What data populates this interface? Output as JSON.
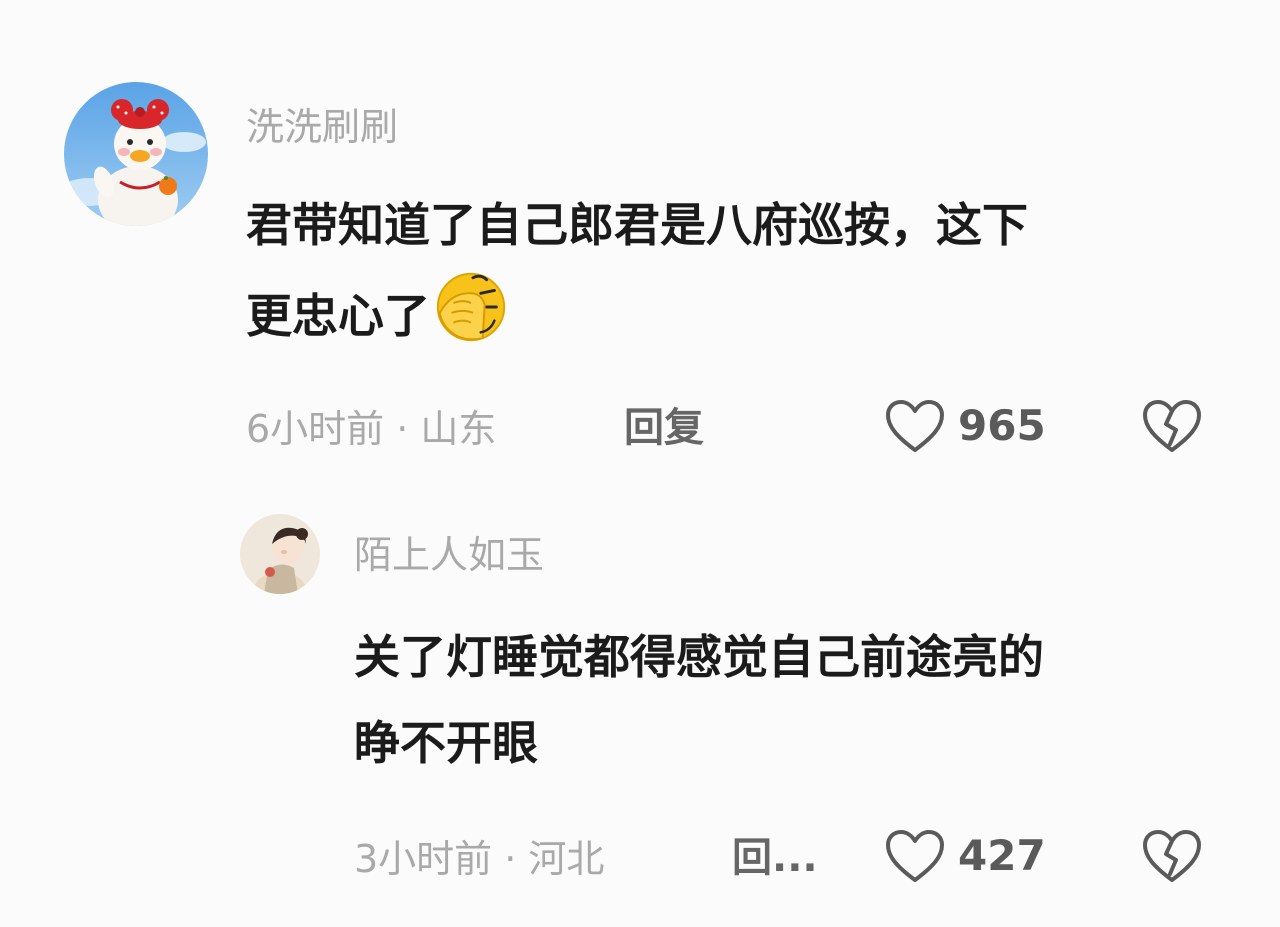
{
  "comments": [
    {
      "username": "洗洗刷刷",
      "content_lines": [
        "君带知道了自己郎君是八府巡按，这下",
        "更忠心了"
      ],
      "emoji": "facepalm-emoji",
      "time": "6小时前",
      "location": "山东",
      "meta": "6小时前 · 山东",
      "reply_label": "回复",
      "likes": "965"
    },
    {
      "username": "陌上人如玉",
      "content_lines": [
        "关了灯睡觉都得感觉自己前途亮的",
        "睁不开眼"
      ],
      "time": "3小时前",
      "location": "河北",
      "meta": "3小时前 · 河北",
      "reply_label": "回...",
      "likes": "427"
    }
  ],
  "icons": {
    "like": "heart-outline-icon",
    "dislike": "broken-heart-icon"
  },
  "colors": {
    "background": "#fbfbfb",
    "username": "#a9a9a9",
    "content": "#1b1b1b",
    "meta": "#a9a9a9",
    "reply": "#666666",
    "icon": "#5a5a5a"
  }
}
